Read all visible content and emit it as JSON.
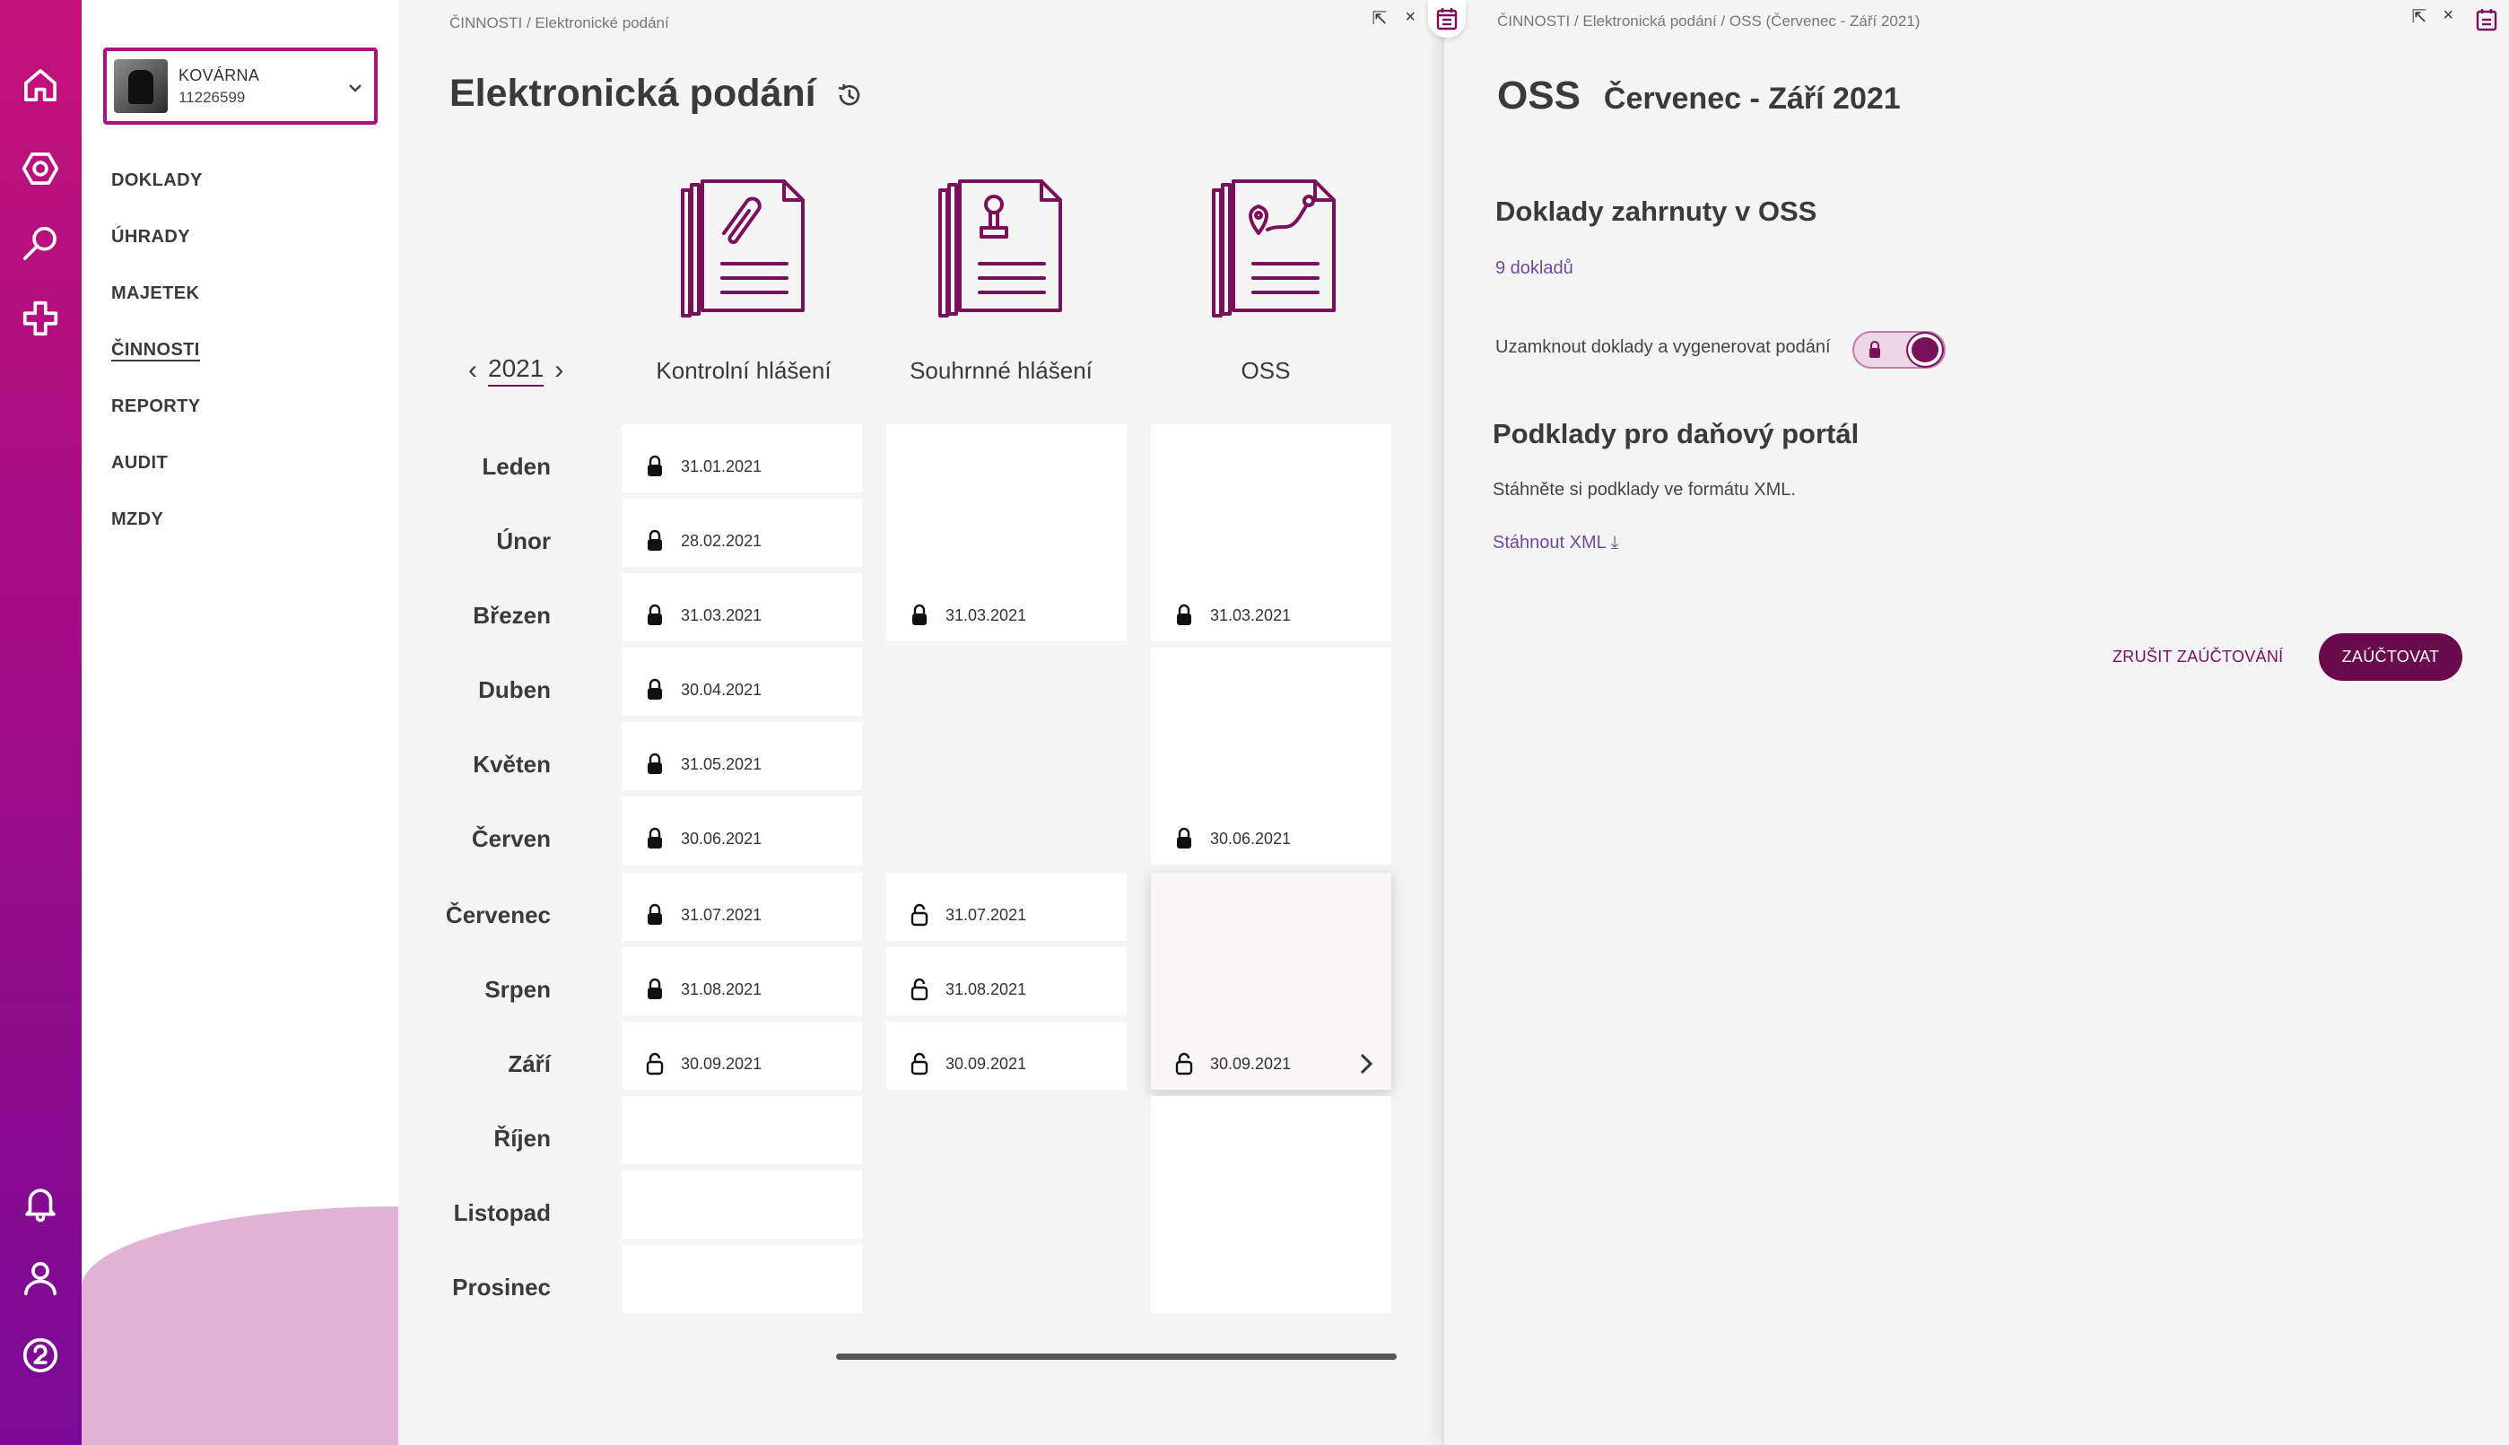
{
  "colors": {
    "brand": "#7a0f5c",
    "rail_top": "#c4117a",
    "rail_bottom": "#7a0a95",
    "nav_blob": "#e0b3d6"
  },
  "rail": {
    "top_icons": [
      "home-icon",
      "settings-hexagon-icon",
      "search-icon",
      "plus-cross-icon"
    ],
    "bottom_icons": [
      "bell-icon",
      "user-icon",
      "help-icon"
    ]
  },
  "company": {
    "name": "KOVÁRNA",
    "id": "11226599"
  },
  "nav": {
    "items": [
      "DOKLADY",
      "ÚHRADY",
      "MAJETEK",
      "ČINNOSTI",
      "REPORTY",
      "AUDIT",
      "MZDY"
    ],
    "active": "ČINNOSTI"
  },
  "main": {
    "breadcrumb": "ČINNOSTI / Elektronické podání",
    "title": "Elektronická podání",
    "tools": {
      "open": "⇱",
      "close": "×"
    },
    "year": "2021",
    "columns": [
      {
        "title": "Kontrolní hlášení",
        "icon": "paperclip-docs-icon"
      },
      {
        "title": "Souhrnné hlášení",
        "icon": "stamp-docs-icon"
      },
      {
        "title": "OSS",
        "icon": "map-pin-docs-icon"
      }
    ],
    "months": [
      "Leden",
      "Únor",
      "Březen",
      "Duben",
      "Květen",
      "Červen",
      "Červenec",
      "Srpen",
      "Září",
      "Říjen",
      "Listopad",
      "Prosinec"
    ],
    "kontrolni": [
      {
        "date": "31.01.2021",
        "locked": true
      },
      {
        "date": "28.02.2021",
        "locked": true
      },
      {
        "date": "31.03.2021",
        "locked": true
      },
      {
        "date": "30.04.2021",
        "locked": true
      },
      {
        "date": "31.05.2021",
        "locked": true
      },
      {
        "date": "30.06.2021",
        "locked": true
      },
      {
        "date": "31.07.2021",
        "locked": true
      },
      {
        "date": "31.08.2021",
        "locked": true
      },
      {
        "date": "30.09.2021",
        "locked": false
      }
    ],
    "souhrnne": [
      {
        "date": "31.03.2021",
        "locked": true
      },
      {
        "date": "31.07.2021",
        "locked": false
      },
      {
        "date": "31.08.2021",
        "locked": false
      },
      {
        "date": "30.09.2021",
        "locked": false
      }
    ],
    "oss": [
      {
        "date": "31.03.2021",
        "locked": true
      },
      {
        "date": "30.06.2021",
        "locked": true
      },
      {
        "date": "30.09.2021",
        "locked": false
      }
    ]
  },
  "detail": {
    "breadcrumb": "ČINNOSTI / Elektronická podání / OSS (Červenec - Září 2021)",
    "title": "OSS",
    "subtitle": "Červenec - Září 2021",
    "section1": "Doklady zahrnuty v OSS",
    "docs_link": "9 dokladů",
    "lock_label": "Uzamknout doklady a vygenerovat podání",
    "lock_on": true,
    "section2": "Podklady pro daňový portál",
    "xml_text": "Stáhněte si podklady ve formátu XML.",
    "xml_link": "Stáhnout XML ⤓",
    "cancel_btn": "ZRUŠIT ZAÚČTOVÁNÍ",
    "submit_btn": "ZAÚČTOVAT"
  }
}
